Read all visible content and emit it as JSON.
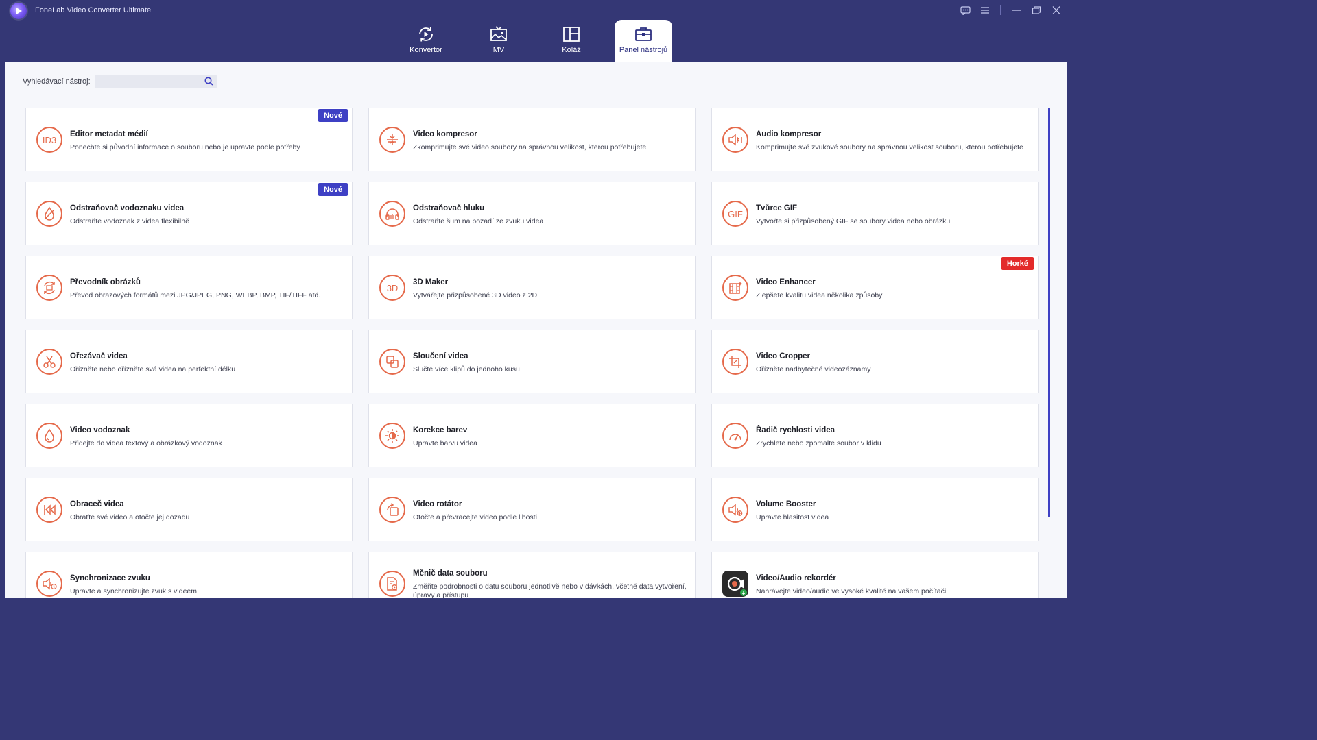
{
  "app": {
    "title": "FoneLab Video Converter Ultimate"
  },
  "nav": {
    "tabs": [
      {
        "label": "Konvertor",
        "icon": "convert-icon"
      },
      {
        "label": "MV",
        "icon": "image-icon"
      },
      {
        "label": "Koláž",
        "icon": "collage-icon"
      },
      {
        "label": "Panel nástrojů",
        "icon": "toolbox-icon"
      }
    ],
    "active": "Panel nástrojů"
  },
  "search": {
    "label": "Vyhledávací nástroj:",
    "value": ""
  },
  "colors": {
    "accent": "#e5694a",
    "brand": "#343775",
    "new_badge": "#3e40c4",
    "hot_badge": "#e32a2a"
  },
  "tools": [
    {
      "title": "Editor metadat médií",
      "desc": "Ponechte si původní informace o souboru nebo je upravte podle potřeby",
      "badge": "Nové",
      "icon": "id3-icon"
    },
    {
      "title": "Video kompresor",
      "desc": "Zkomprimujte své video soubory na správnou velikost, kterou potřebujete",
      "badge": "",
      "icon": "compress-icon"
    },
    {
      "title": "Audio kompresor",
      "desc": "Komprimujte své zvukové soubory na správnou velikost souboru, kterou potřebujete",
      "badge": "",
      "icon": "audio-compress-icon"
    },
    {
      "title": "Odstraňovač vodoznaku videa",
      "desc": "Odstraňte vodoznak z videa flexibilně",
      "badge": "Nové",
      "icon": "watermark-remove-icon"
    },
    {
      "title": "Odstraňovač hluku",
      "desc": "Odstraňte šum na pozadí ze zvuku videa",
      "badge": "",
      "icon": "headphones-icon"
    },
    {
      "title": "Tvůrce GIF",
      "desc": "Vytvořte si přizpůsobený GIF se soubory videa nebo obrázku",
      "badge": "",
      "icon": "gif-icon"
    },
    {
      "title": "Převodník obrázků",
      "desc": "Převod obrazových formátů mezi JPG/JPEG, PNG, WEBP, BMP, TIF/TIFF atd.",
      "badge": "",
      "icon": "image-convert-icon"
    },
    {
      "title": "3D Maker",
      "desc": "Vytvářejte přizpůsobené 3D video z 2D",
      "badge": "",
      "icon": "3d-icon"
    },
    {
      "title": "Video Enhancer",
      "desc": "Zlepšete kvalitu videa několika způsoby",
      "badge": "Horké",
      "icon": "enhance-icon"
    },
    {
      "title": "Ořezávač videa",
      "desc": "Ořízněte nebo ořízněte svá videa na perfektní délku",
      "badge": "",
      "icon": "scissors-icon"
    },
    {
      "title": "Sloučení videa",
      "desc": "Slučte více klipů do jednoho kusu",
      "badge": "",
      "icon": "merge-icon"
    },
    {
      "title": "Video Cropper",
      "desc": "Ořízněte nadbytečné videozáznamy",
      "badge": "",
      "icon": "crop-icon"
    },
    {
      "title": "Video vodoznak",
      "desc": "Přidejte do videa textový a obrázkový vodoznak",
      "badge": "",
      "icon": "drop-icon"
    },
    {
      "title": "Korekce barev",
      "desc": "Upravte barvu videa",
      "badge": "",
      "icon": "sun-icon"
    },
    {
      "title": "Řadič rychlosti videa",
      "desc": "Zrychlete nebo zpomalte soubor v klidu",
      "badge": "",
      "icon": "speedometer-icon"
    },
    {
      "title": "Obraceč videa",
      "desc": "Obraťte své video a otočte jej dozadu",
      "badge": "",
      "icon": "rewind-icon"
    },
    {
      "title": "Video rotátor",
      "desc": "Otočte a převracejte video podle libosti",
      "badge": "",
      "icon": "rotate-icon"
    },
    {
      "title": "Volume Booster",
      "desc": "Upravte hlasitost videa",
      "badge": "",
      "icon": "volume-boost-icon"
    },
    {
      "title": "Synchronizace zvuku",
      "desc": "Upravte a synchronizujte zvuk s videem",
      "badge": "",
      "icon": "sync-audio-icon"
    },
    {
      "title": "Měnič data souboru",
      "desc": "Změňte podrobnosti o datu souboru jednotlivě nebo v dávkách, včetně data vytvoření, úpravy a přístupu",
      "badge": "",
      "icon": "file-date-icon"
    },
    {
      "title": "Video/Audio rekordér",
      "desc": "Nahrávejte video/audio ve vysoké kvalitě na vašem počítači",
      "badge": "",
      "icon": "recorder-icon"
    }
  ]
}
